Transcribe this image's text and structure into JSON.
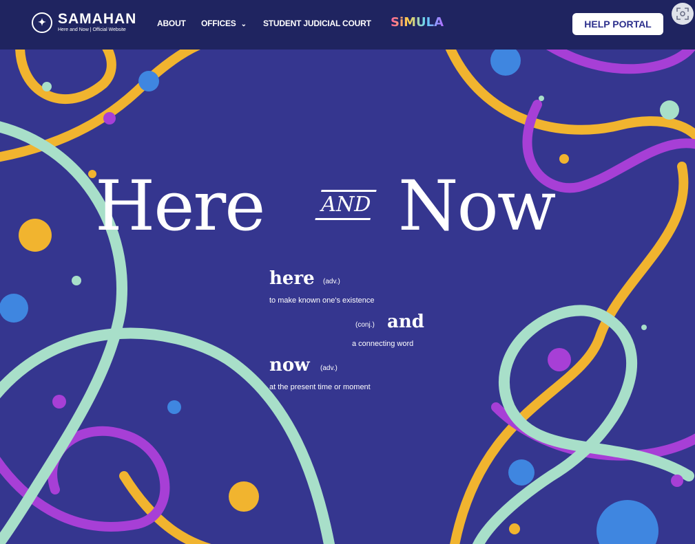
{
  "navbar": {
    "logo_title": "SAMAHAN",
    "logo_subtitle": "Here and Now | Official Website",
    "items": [
      {
        "label": "ABOUT"
      },
      {
        "label": "OFFICES"
      },
      {
        "label": "STUDENT JUDICIAL COURT"
      }
    ],
    "simula_label": "SiMULA",
    "help_label": "HELP PORTAL",
    "scan_icon": "screen-scan-icon"
  },
  "hero": {
    "word_here": "Here",
    "word_and": "AND",
    "word_now": "Now"
  },
  "definitions": [
    {
      "word": "here",
      "pos": "(adv.)",
      "meaning": "to make known one's existence"
    },
    {
      "word": "and",
      "pos": "(conj.)",
      "meaning": "a connecting word"
    },
    {
      "word": "now",
      "pos": "(adv.)",
      "meaning": "at the present time or moment"
    }
  ],
  "colors": {
    "background": "#35368f",
    "navbar": "#1f2460",
    "accent_yellow": "#f1b42f",
    "accent_mint": "#a8dfc9",
    "accent_purple": "#a73fd6",
    "accent_blue": "#3f86e0"
  }
}
